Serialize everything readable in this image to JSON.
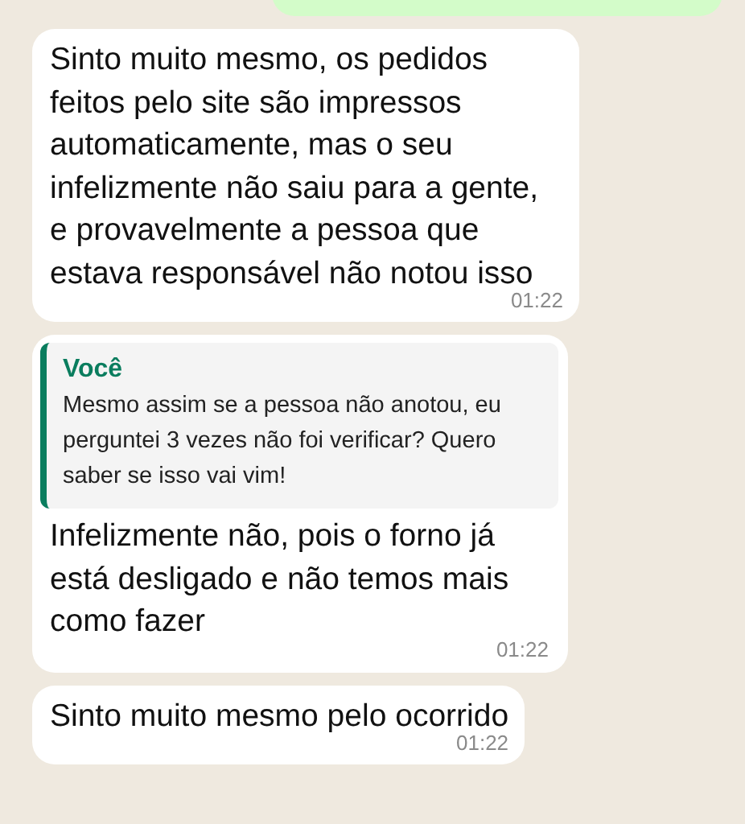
{
  "sent_bubble": {
    "kind": "outgoing"
  },
  "messages": [
    {
      "kind": "text",
      "text": "Sinto muito mesmo, os pedidos feitos pelo site são impressos automaticamente, mas o seu infelizmente não saiu para a gente, e provavelmente a pessoa que estava responsável não notou isso",
      "time": "01:22"
    },
    {
      "kind": "reply",
      "quote": {
        "author": "Você",
        "text": "Mesmo assim se a pessoa não anotou, eu perguntei 3 vezes não foi verificar? Quero saber se isso vai vim!"
      },
      "text": "Infelizmente não, pois o forno já está desligado e não temos mais como fazer",
      "time": "01:22"
    },
    {
      "kind": "text",
      "text": "Sinto muito mesmo pelo ocorrido",
      "time": "01:22"
    }
  ]
}
